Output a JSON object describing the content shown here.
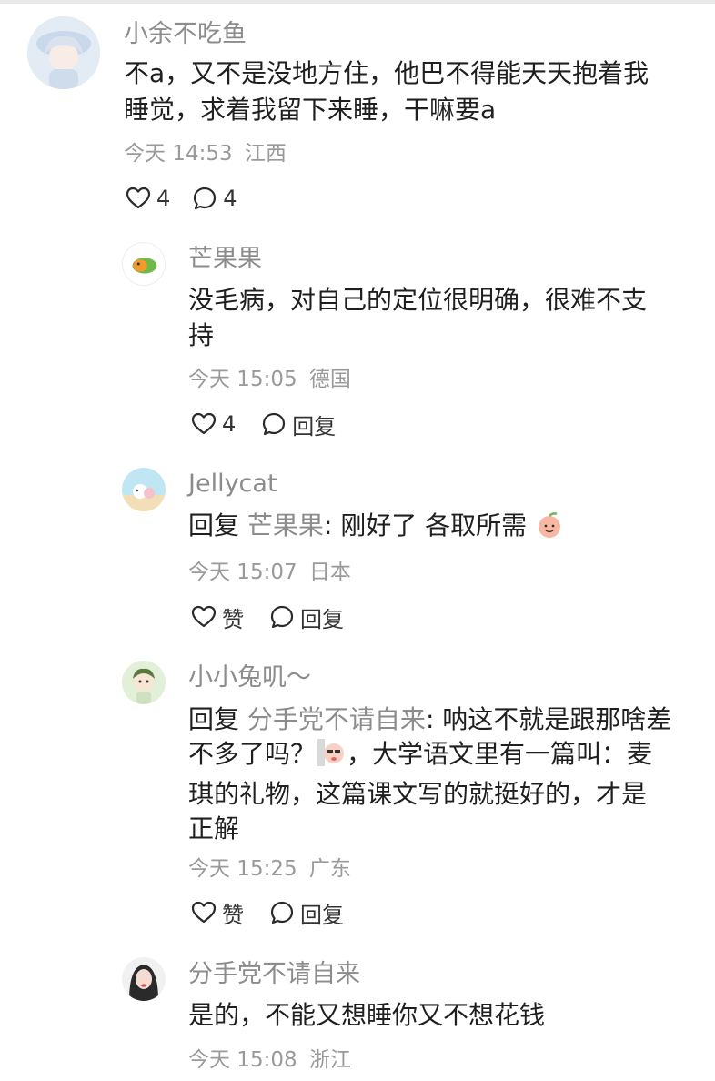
{
  "comments": [
    {
      "user": "小余不吃鱼",
      "text": "不a，又不是没地方住，他巴不得能天天抱着我睡觉，求着我留下来睡，干嘛要a",
      "line1": "不a，又不是没地方住，他巴不得能天天抱着我",
      "line2": "睡觉，求着我留下来睡，干嘛要a",
      "time": "今天 14:53",
      "location": "江西",
      "likes": "4",
      "replies": "4"
    },
    {
      "user": "芒果果",
      "line1": "没毛病，对自己的定位很明确，很难不支",
      "line2": "持",
      "time": "今天 15:05",
      "location": "德国",
      "likes": "4",
      "reply_label": "回复"
    },
    {
      "user": "Jellycat",
      "reply_prefix": "回复",
      "reply_to": "芒果果",
      "body": ": 刚好了 各取所需",
      "time": "今天 15:07",
      "location": "日本",
      "like_label": "赞",
      "reply_label": "回复"
    },
    {
      "user": "小小兔叽～",
      "reply_prefix": "回复",
      "reply_to": "分手党不请自来",
      "line1_body": ": 呐这不就是跟那啥差",
      "line2a": "不多了吗？",
      "line2b": "，大学语文里有一篇叫：麦",
      "line3": "琪的礼物，这篇课文写的就挺好的，才是",
      "line4": "正解",
      "time": "今天 15:25",
      "location": "广东",
      "like_label": "赞",
      "reply_label": "回复"
    },
    {
      "user": "分手党不请自来",
      "line1": "是的，不能又想睡你又不想花钱",
      "time": "今天 15:08",
      "location": "浙江"
    }
  ],
  "icons": {
    "like": "heart-outline-icon",
    "reply": "comment-bubble-icon"
  },
  "colors": {
    "text": "#1f1f1f",
    "secondary": "#8c8c8c",
    "meta": "#9a9a9a"
  }
}
